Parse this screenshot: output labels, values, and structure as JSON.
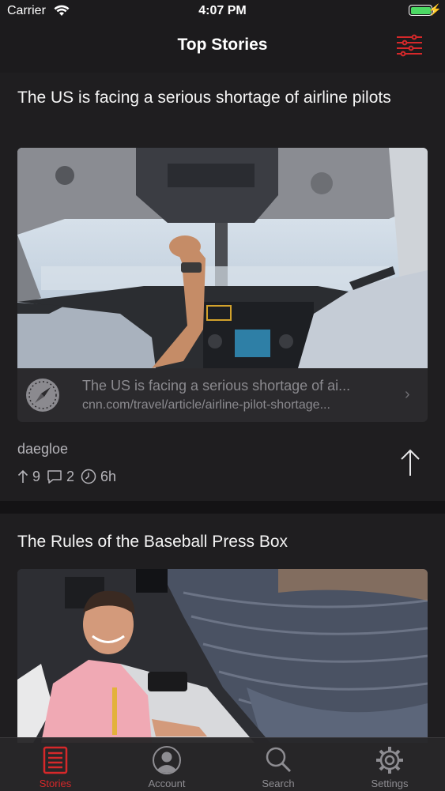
{
  "status_bar": {
    "carrier": "Carrier",
    "time": "4:07 PM"
  },
  "nav": {
    "title": "Top Stories",
    "filter_icon": "sliders-icon"
  },
  "colors": {
    "accent": "#d6282a",
    "background": "#1c1b1d",
    "card": "#1f1e20",
    "muted": "#8b8a8f"
  },
  "stories": [
    {
      "headline": "The US is facing a serious shortage of airline pilots",
      "link_title": "The US is facing a serious shortage of ai...",
      "link_url": "cnn.com/travel/article/airline-pilot-shortage...",
      "author": "daegloe",
      "points": "9",
      "comments": "2",
      "age": "6h"
    },
    {
      "headline": "The Rules of the Baseball Press Box"
    }
  ],
  "tabs": [
    {
      "label": "Stories",
      "icon": "stories-icon",
      "active": true
    },
    {
      "label": "Account",
      "icon": "account-icon",
      "active": false
    },
    {
      "label": "Search",
      "icon": "search-icon",
      "active": false
    },
    {
      "label": "Settings",
      "icon": "settings-gear-icon",
      "active": false
    }
  ]
}
